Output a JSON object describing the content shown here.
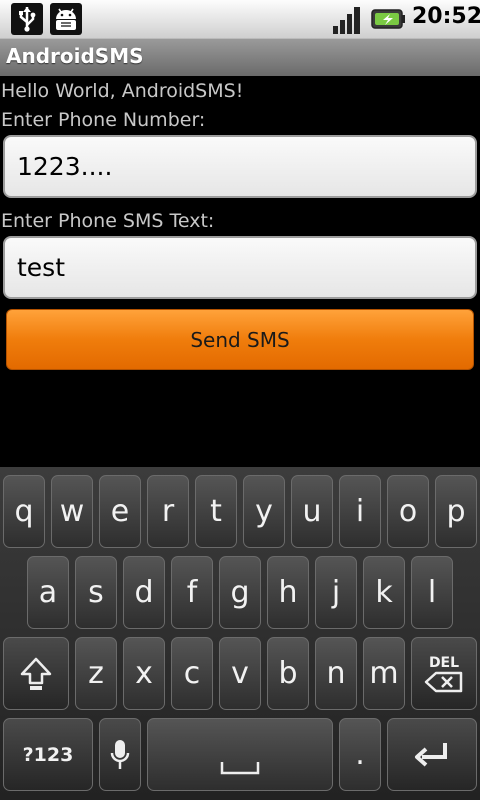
{
  "status_bar": {
    "time": "20:52",
    "icons": [
      "usb-icon",
      "android-debug-icon",
      "signal-icon",
      "battery-charging-icon"
    ]
  },
  "app": {
    "title": "AndroidSMS"
  },
  "content": {
    "hello_text": "Hello World, AndroidSMS!",
    "phone_label": "Enter Phone Number:",
    "phone_value": "1223....",
    "sms_label": "Enter Phone SMS Text:",
    "sms_value": "test",
    "send_button_label": "Send SMS"
  },
  "keyboard": {
    "row1": [
      "q",
      "w",
      "e",
      "r",
      "t",
      "y",
      "u",
      "i",
      "o",
      "p"
    ],
    "row2": [
      "a",
      "s",
      "d",
      "f",
      "g",
      "h",
      "j",
      "k",
      "l"
    ],
    "row3": [
      "z",
      "x",
      "c",
      "v",
      "b",
      "n",
      "m"
    ],
    "symbols_label": "?123",
    "delete_label": "DEL",
    "period_label": "."
  },
  "colors": {
    "accent": "#f07d0c",
    "background": "#000000",
    "label_text": "#c8c8c8"
  }
}
